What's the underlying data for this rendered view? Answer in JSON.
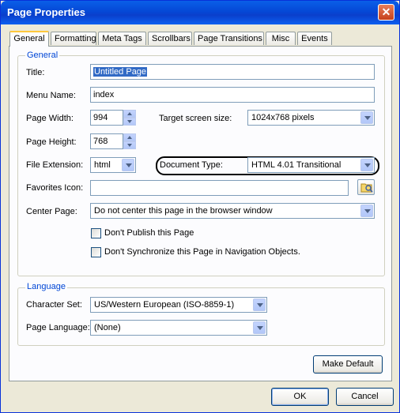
{
  "window": {
    "title": "Page Properties",
    "close_label": "✕"
  },
  "tabs": [
    "General",
    "Formatting",
    "Meta Tags",
    "Scrollbars",
    "Page Transitions",
    "Misc",
    "Events"
  ],
  "general": {
    "group_label": "General",
    "title_label": "Title:",
    "title_value": "Untitled Page",
    "menu_name_label": "Menu Name:",
    "menu_name_value": "index",
    "page_width_label": "Page Width:",
    "page_width_value": "994",
    "target_screen_label": "Target screen size:",
    "target_screen_value": "1024x768 pixels",
    "page_height_label": "Page Height:",
    "page_height_value": "768",
    "file_ext_label": "File Extension:",
    "file_ext_value": "html",
    "doc_type_label": "Document Type:",
    "doc_type_value": "HTML 4.01 Transitional",
    "favicon_label": "Favorites Icon:",
    "favicon_value": "",
    "center_page_label": "Center Page:",
    "center_page_value": "Do not center this page in the browser window",
    "dont_publish_label": "Don't Publish this Page",
    "dont_sync_label": "Don't Synchronize this Page in Navigation Objects."
  },
  "language": {
    "group_label": "Language",
    "charset_label": "Character Set:",
    "charset_value": "US/Western European (ISO-8859-1)",
    "page_lang_label": "Page Language:",
    "page_lang_value": "(None)"
  },
  "buttons": {
    "make_default": "Make Default",
    "ok": "OK",
    "cancel": "Cancel"
  },
  "colors": {
    "titlebar": "#0a5fe8",
    "group_label": "#0046d5",
    "selection": "#316ac5",
    "dialog_bg": "#ece9d8"
  }
}
